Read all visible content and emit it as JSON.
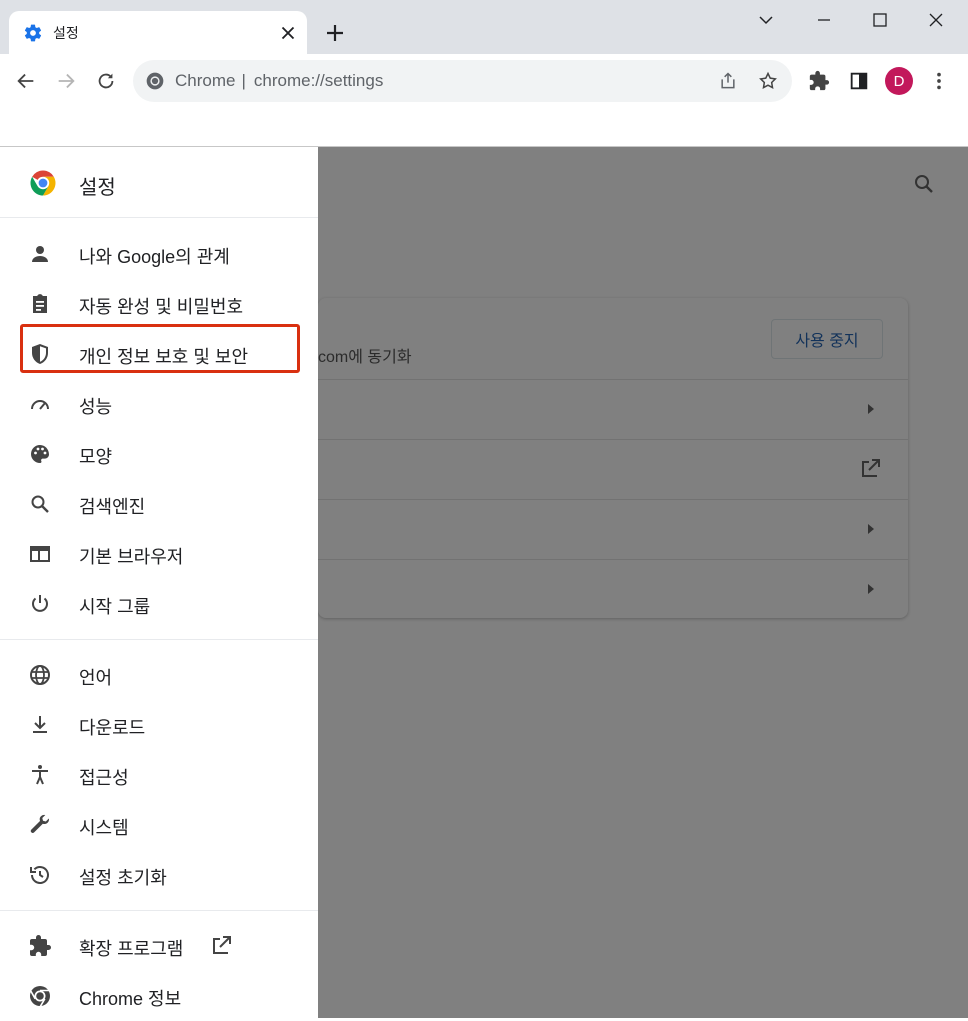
{
  "tab": {
    "title": "설정",
    "icon": "gear-icon"
  },
  "omnibox": {
    "site_label": "Chrome",
    "url": "chrome://settings"
  },
  "profile": {
    "initial": "D",
    "color": "#c2185b"
  },
  "accent": "#1a73e8",
  "highlight_color": "#d93010",
  "sidebar": {
    "title": "설정",
    "items": [
      {
        "label": "나와 Google의 관계",
        "icon": "person-icon"
      },
      {
        "label": "자동 완성 및 비밀번호",
        "icon": "clipboard-icon"
      },
      {
        "label": "개인 정보 보호 및 보안",
        "icon": "shield-icon"
      },
      {
        "label": "성능",
        "icon": "speedometer-icon"
      },
      {
        "label": "모양",
        "icon": "palette-icon"
      },
      {
        "label": "검색엔진",
        "icon": "search-icon"
      },
      {
        "label": "기본 브라우저",
        "icon": "browser-window-icon"
      },
      {
        "label": "시작 그룹",
        "icon": "power-icon"
      },
      {
        "label": "언어",
        "icon": "globe-icon"
      },
      {
        "label": "다운로드",
        "icon": "download-icon"
      },
      {
        "label": "접근성",
        "icon": "accessibility-icon"
      },
      {
        "label": "시스템",
        "icon": "wrench-icon"
      },
      {
        "label": "설정 초기화",
        "icon": "history-icon"
      },
      {
        "label": "확장 프로그램",
        "icon": "puzzle-icon"
      },
      {
        "label": "Chrome 정보",
        "icon": "chrome-logo-icon"
      }
    ]
  },
  "main": {
    "sync_text": "com에 동기화",
    "sync_button": "사용 중지"
  }
}
